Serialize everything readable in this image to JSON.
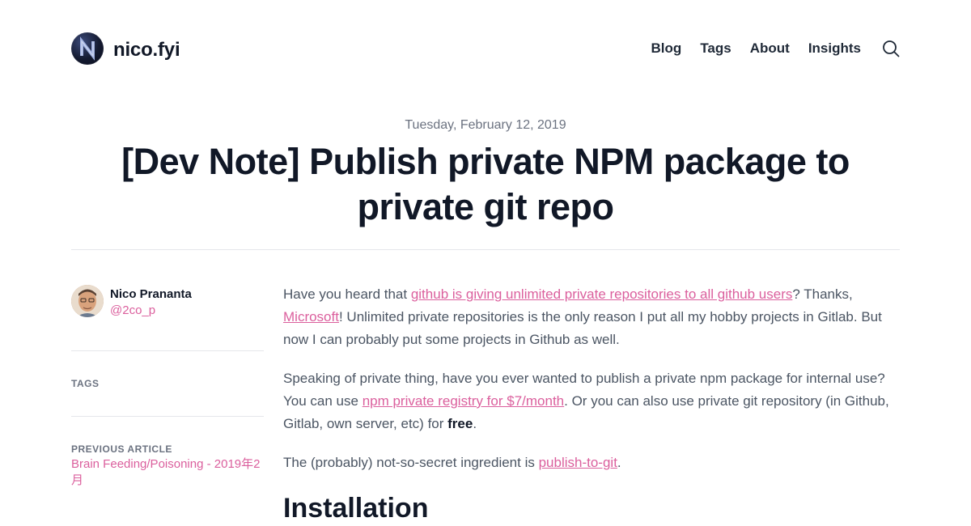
{
  "header": {
    "site_name": "nico.fyi",
    "nav": [
      "Blog",
      "Tags",
      "About",
      "Insights"
    ]
  },
  "post": {
    "date": "Tuesday, February 12, 2019",
    "title": "[Dev Note] Publish private NPM package to private git repo"
  },
  "author": {
    "name": "Nico Prananta",
    "handle": "@2co_p"
  },
  "sidebar": {
    "tags_label": "TAGS",
    "previous_label": "PREVIOUS ARTICLE",
    "previous_title": "Brain Feeding/Poisoning - 2019年2月"
  },
  "content": {
    "p1_text1": "Have you heard that ",
    "p1_link1": "github is giving unlimited private repositories to all github users",
    "p1_text2": "? Thanks, ",
    "p1_link2": "Microsoft",
    "p1_text3": "! Unlimited private repositories is the only reason I put all my hobby projects in Gitlab. But now I can probably put some projects in Github as well.",
    "p2_text1": "Speaking of private thing, have you ever wanted to publish a private npm package for internal use? You can use ",
    "p2_link1": "npm private registry for $7/month",
    "p2_text2": ". Or you can also use private git repository (in Github, Gitlab, own server, etc) for ",
    "p2_bold": "free",
    "p2_text3": ".",
    "p3_text1": "The (probably) not-so-secret ingredient is ",
    "p3_link1": "publish-to-git",
    "p3_text2": ".",
    "heading": "Installation"
  },
  "colors": {
    "accent": "#db5f9d",
    "text": "#111827",
    "muted": "#6b7280"
  },
  "icons": {
    "logo": "n-logo-icon",
    "search": "search-icon"
  }
}
